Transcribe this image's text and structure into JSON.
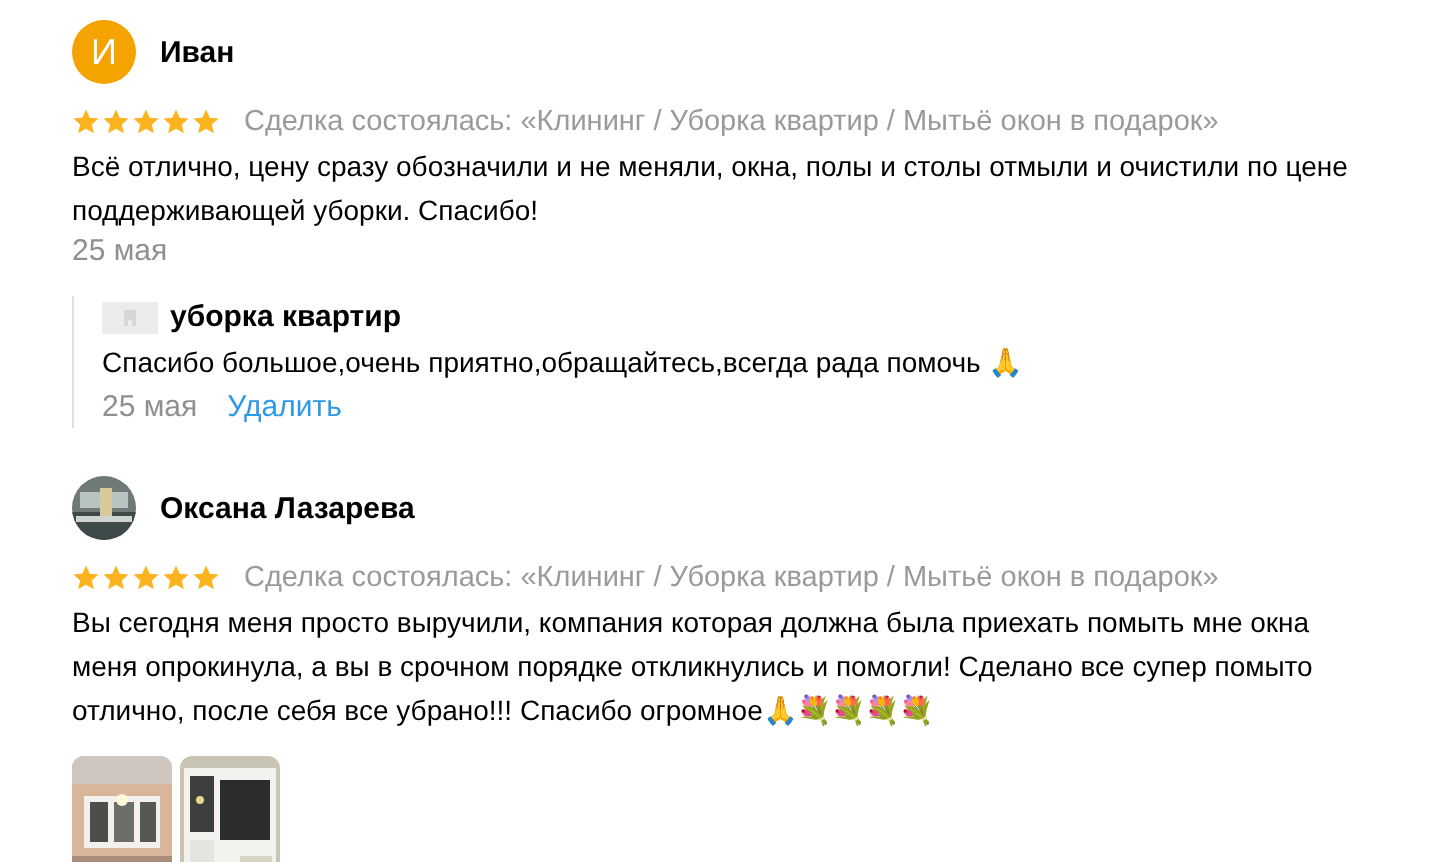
{
  "reviews": [
    {
      "avatar": {
        "kind": "letter",
        "letter": "И",
        "color": "#f5a300"
      },
      "author": "Иван",
      "stars": 5,
      "deal": "Сделка состоялась: «Клининг / Уборка квартир / Мытьё окон в подарок»",
      "text": "Всё отлично, цену сразу обозначили и не меняли, окна, полы и столы отмыли и очистили по цене поддерживающей уборки. Спасибо!",
      "date": "25 мая",
      "reply": {
        "author": "уборка квартир",
        "text": "Спасибо большое,очень приятно,обращайтесь,всегда рада помочь 🙏",
        "date": "25 мая",
        "action": "Удалить"
      }
    },
    {
      "avatar": {
        "kind": "picture"
      },
      "author": "Оксана Лазарева",
      "stars": 5,
      "deal": "Сделка состоялась: «Клининг / Уборка квартир / Мытьё окон в подарок»",
      "text": "Вы сегодня меня просто выручили, компания которая должна была приехать помыть мне окна меня опрокинула, а вы в срочном порядке откликнулись и помогли! Сделано все супер помыто отлично, после себя все убрано!!! Спасибо огромное🙏💐💐💐💐",
      "photos": [
        {
          "kind": "picture"
        },
        {
          "kind": "picture"
        }
      ]
    }
  ]
}
